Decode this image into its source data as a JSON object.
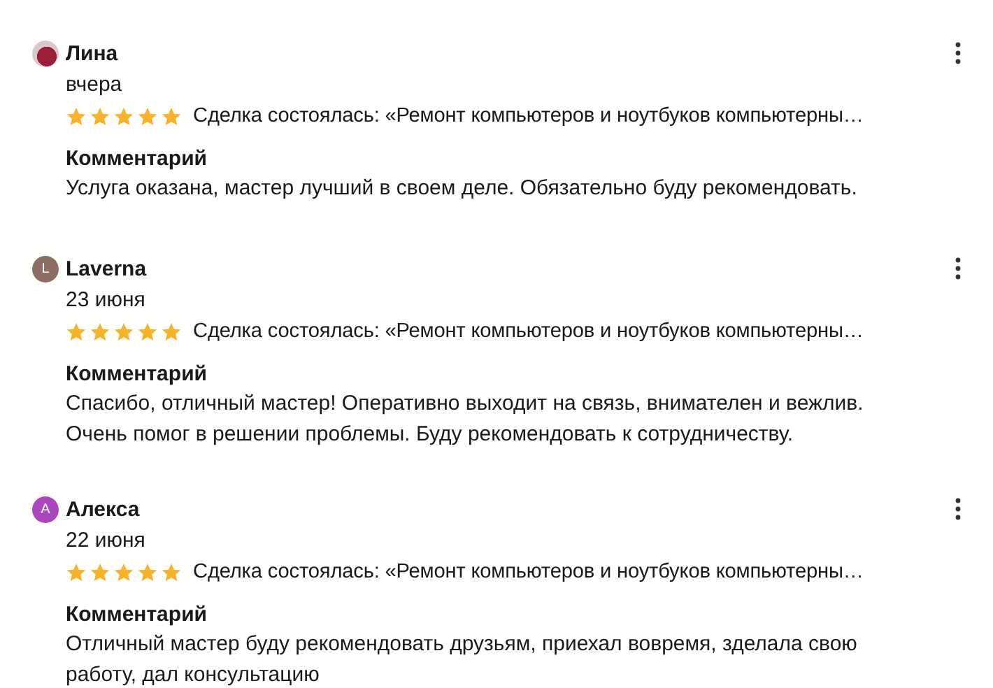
{
  "reviews": [
    {
      "author": "Лина",
      "avatar": {
        "kind": "photo"
      },
      "date": "вчера",
      "stars": 5,
      "deal": "Сделка состоялась: «Ремонт компьютеров и ноутбуков компьютерны…",
      "comment_title": "Комментарий",
      "comment": "Услуга оказана, мастер лучший в своем деле. Обязательно буду рекомендовать."
    },
    {
      "author": "Laverna",
      "avatar": {
        "kind": "letter",
        "letter": "L",
        "color": "#8d6e63"
      },
      "date": "23 июня",
      "stars": 5,
      "deal": "Сделка состоялась: «Ремонт компьютеров и ноутбуков компьютерны…",
      "comment_title": "Комментарий",
      "comment": "Спасибо, отличный мастер! Оперативно выходит на связь, внимателен и вежлив. Очень помог в решении проблемы. Буду рекомендовать к сотрудничеству."
    },
    {
      "author": "Алекса",
      "avatar": {
        "kind": "letter",
        "letter": "А",
        "color": "#ab47bc"
      },
      "date": "22 июня",
      "stars": 5,
      "deal": "Сделка состоялась: «Ремонт компьютеров и ноутбуков компьютерны…",
      "comment_title": "Комментарий",
      "comment": "Отличный мастер буду рекомендовать друзьям, приехал вовремя, зделала свою работу, дал консультацию"
    }
  ]
}
